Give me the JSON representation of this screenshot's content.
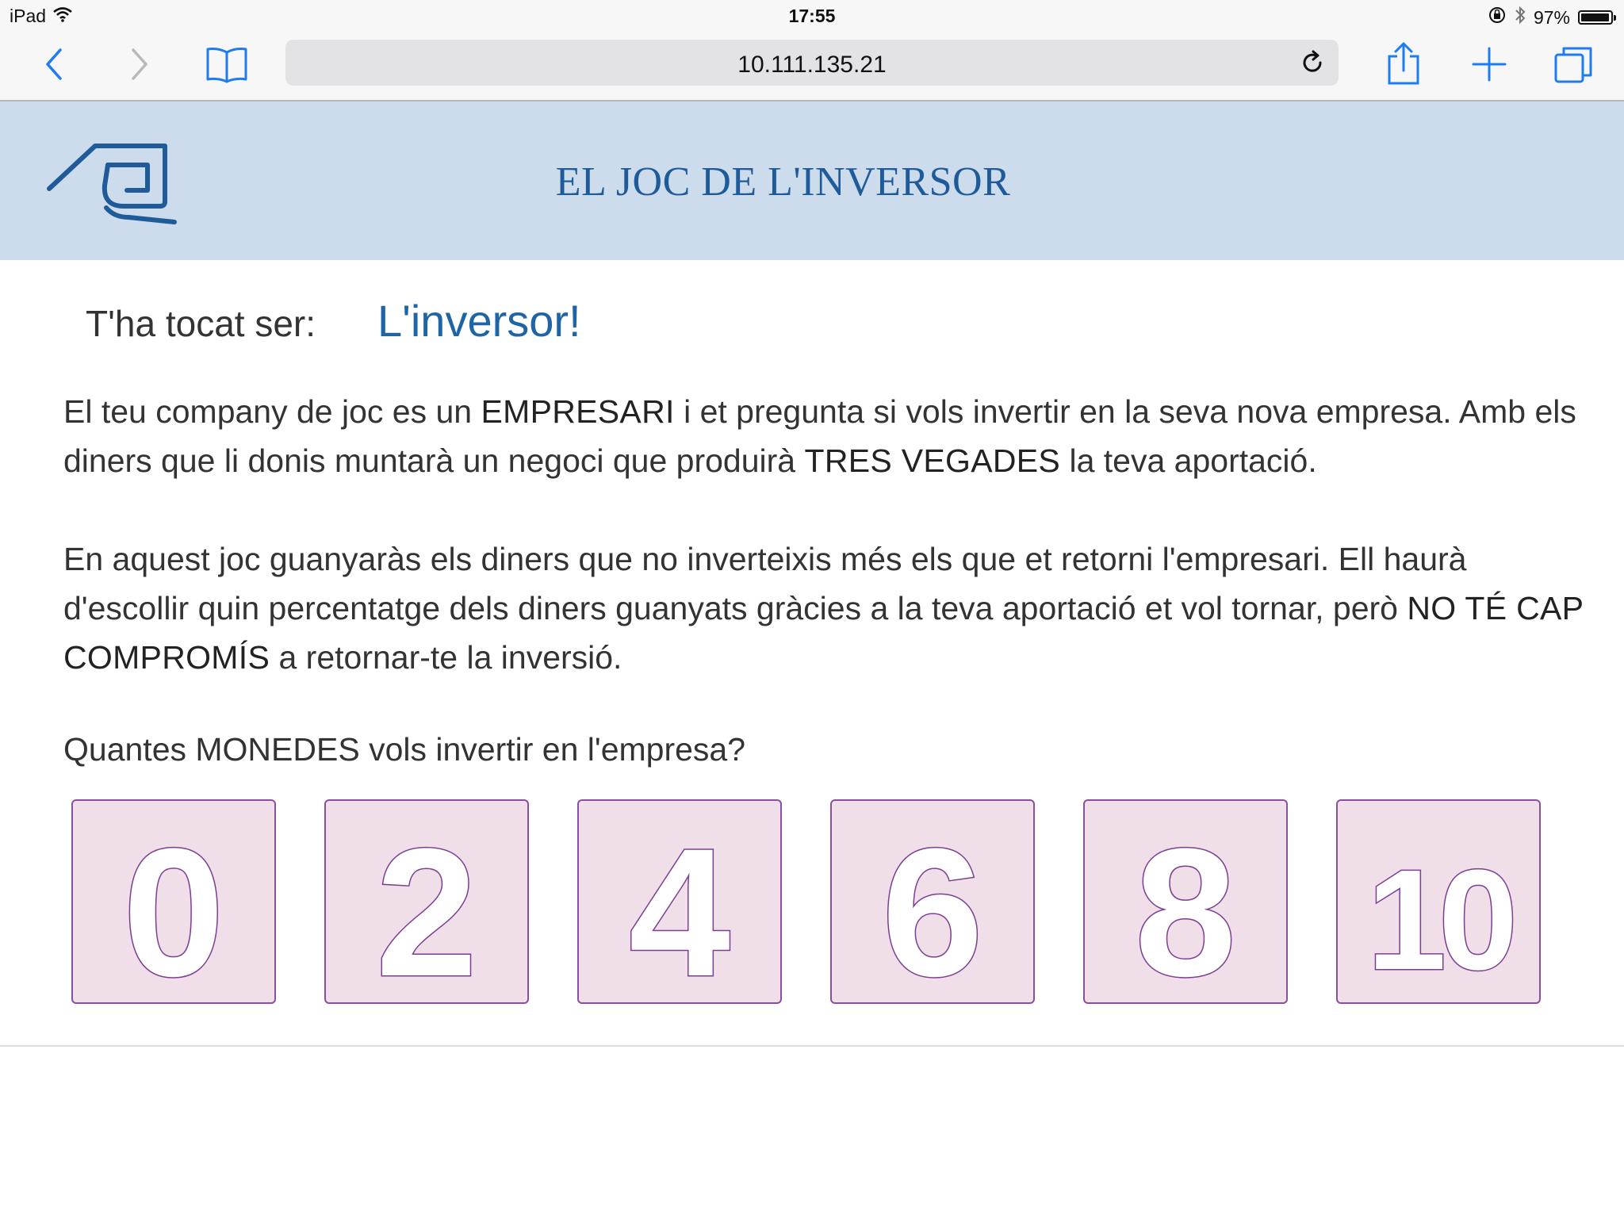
{
  "status_bar": {
    "device": "iPad",
    "time": "17:55",
    "battery_text": "97%",
    "battery_level": 0.97
  },
  "browser": {
    "url": "10.111.135.21"
  },
  "header": {
    "title": "EL JOC DE L'INVERSOR"
  },
  "role": {
    "label": "T'ha tocat ser:",
    "value": "L'inversor!"
  },
  "paragraph1": {
    "t1": "El teu company de joc es un ",
    "b1": "EMPRESARI",
    "t2": " i et pregunta si vols invertir en la seva nova empresa. Amb els diners que li donis muntarà un negoci que produirà ",
    "b2": "TRES VEGADES",
    "t3": " la teva aportació."
  },
  "paragraph2": {
    "t1": "En aquest joc guanyaràs els diners que no inverteixis més els que et retorni l'empresari. Ell haurà d'escollir quin percentatge dels diners guanyats gràcies a la teva aportació et vol tornar, però ",
    "b1": "NO TÉ CAP COMPROMÍS",
    "t2": " a retornar-te la inversió."
  },
  "question": "Quantes MONEDES vols invertir en l'empresa?",
  "coins": [
    "0",
    "2",
    "4",
    "6",
    "8",
    "10"
  ],
  "colors": {
    "header_bg": "#cddced",
    "accent_blue": "#1f5b99",
    "coin_bg": "#f0dfe8",
    "coin_border": "#8a4f9e"
  }
}
